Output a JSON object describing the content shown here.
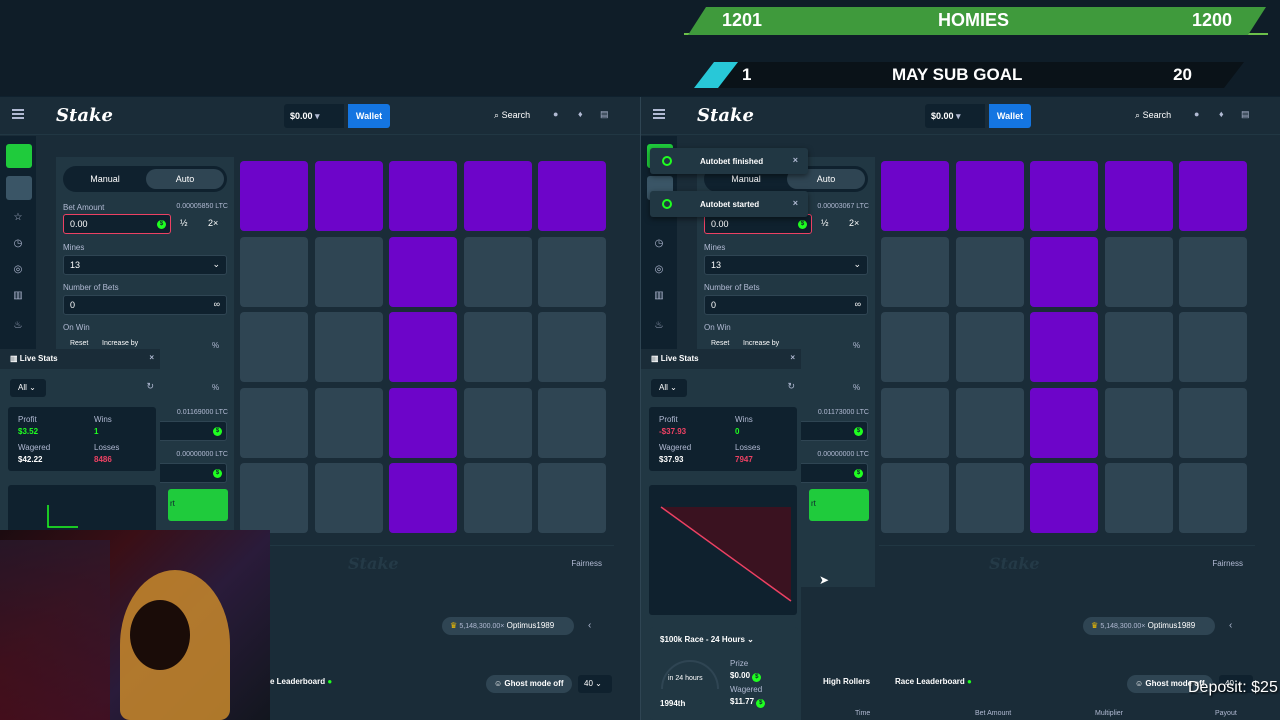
{
  "overlay": {
    "bar1": {
      "left": "1201",
      "title": "HOMIES",
      "right": "1200"
    },
    "bar2": {
      "left": "1",
      "title": "MAY SUB GOAL",
      "right": "20"
    }
  },
  "deposit_text": "Deposit: $25",
  "colors": {
    "gem": "#6d05c9",
    "tile": "#2f4553",
    "accent_green": "#1fff20",
    "wallet": "#1475e1",
    "loss_red": "#ed4163"
  },
  "panels": [
    {
      "logo": "Stake",
      "balance": "$0.00",
      "wallet_label": "Wallet",
      "search_label": "Search",
      "tabs": {
        "manual": "Manual",
        "auto": "Auto"
      },
      "bet_amount_label": "Bet Amount",
      "bet_amount_crypto": "0.00005850 LTC",
      "bet_amount_value": "0.00",
      "half_label": "½",
      "double_label": "2×",
      "mines_label": "Mines",
      "mines_value": "13",
      "number_of_bets_label": "Number of Bets",
      "number_of_bets_value": "0",
      "infinity_symbol": "∞",
      "on_win_label": "On Win",
      "reset_label": "Reset",
      "increase_label": "Increase by",
      "percent_sign": "%",
      "stop_profit_crypto": "0.01169000 LTC",
      "stop_loss_crypto": "0.00000000 LTC",
      "start_suffix": "rt",
      "gems": [
        [
          0,
          0
        ],
        [
          0,
          1
        ],
        [
          0,
          2
        ],
        [
          0,
          3
        ],
        [
          0,
          4
        ],
        [
          1,
          2
        ],
        [
          2,
          2
        ],
        [
          3,
          2
        ],
        [
          4,
          2
        ]
      ],
      "fairness_label": "Fairness",
      "watermark": "Stake",
      "race_chip_value": "5,148,300.00×",
      "race_chip_user": "Optimus1989",
      "leaderboard_tab": "e Leaderboard",
      "ghost_mode": "Ghost mode off",
      "page_size": "40",
      "live_stats": {
        "title": "Live Stats",
        "filter": "All",
        "profit_label": "Profit",
        "profit_value": "$3.52",
        "wins_label": "Wins",
        "wins_value": "1",
        "wagered_label": "Wagered",
        "wagered_value": "$42.22",
        "losses_label": "Losses",
        "losses_value": "8486"
      }
    },
    {
      "logo": "Stake",
      "balance": "$0.00",
      "wallet_label": "Wallet",
      "search_label": "Search",
      "tabs": {
        "manual": "Manual",
        "auto": "Auto"
      },
      "bet_amount_crypto": "0.00003067 LTC",
      "bet_amount_value": "0.00",
      "half_label": "½",
      "double_label": "2×",
      "mines_label": "Mines",
      "mines_value": "13",
      "number_of_bets_label": "Number of Bets",
      "number_of_bets_value": "0",
      "infinity_symbol": "∞",
      "on_win_label": "On Win",
      "reset_label": "Reset",
      "increase_label": "Increase by",
      "percent_sign": "%",
      "stop_profit_crypto": "0.01173000 LTC",
      "stop_loss_crypto": "0.00000000 LTC",
      "start_suffix": "rt",
      "gems": [
        [
          0,
          0
        ],
        [
          0,
          1
        ],
        [
          0,
          2
        ],
        [
          0,
          3
        ],
        [
          0,
          4
        ],
        [
          1,
          2
        ],
        [
          2,
          2
        ],
        [
          3,
          2
        ],
        [
          4,
          2
        ]
      ],
      "fairness_label": "Fairness",
      "watermark": "Stake",
      "race_chip_value": "5,148,300.00×",
      "race_chip_user": "Optimus1989",
      "high_rollers_tab": "High Rollers",
      "race_leaderboard_tab": "Race Leaderboard",
      "ghost_mode": "Ghost mode off",
      "page_size": "40",
      "toasts": [
        {
          "text": "Autobet finished",
          "close": "×"
        },
        {
          "text": "Autobet started",
          "close": "×"
        }
      ],
      "live_stats": {
        "title": "Live Stats",
        "filter": "All",
        "profit_label": "Profit",
        "profit_value": "-$37.93",
        "wins_label": "Wins",
        "wins_value": "0",
        "wagered_label": "Wagered",
        "wagered_value": "$37.93",
        "losses_label": "Losses",
        "losses_value": "7947"
      },
      "race": {
        "title": "$100k Race - 24 Hours",
        "gauge_label": "in 24 hours",
        "rank": "1994th",
        "prize_label": "Prize",
        "prize_value": "$0.00",
        "wagered_label": "Wagered",
        "wagered_value": "$11.77"
      },
      "table_headers": {
        "time": "Time",
        "bet_amount": "Bet Amount",
        "multiplier": "Multiplier",
        "payout": "Payout"
      }
    }
  ]
}
